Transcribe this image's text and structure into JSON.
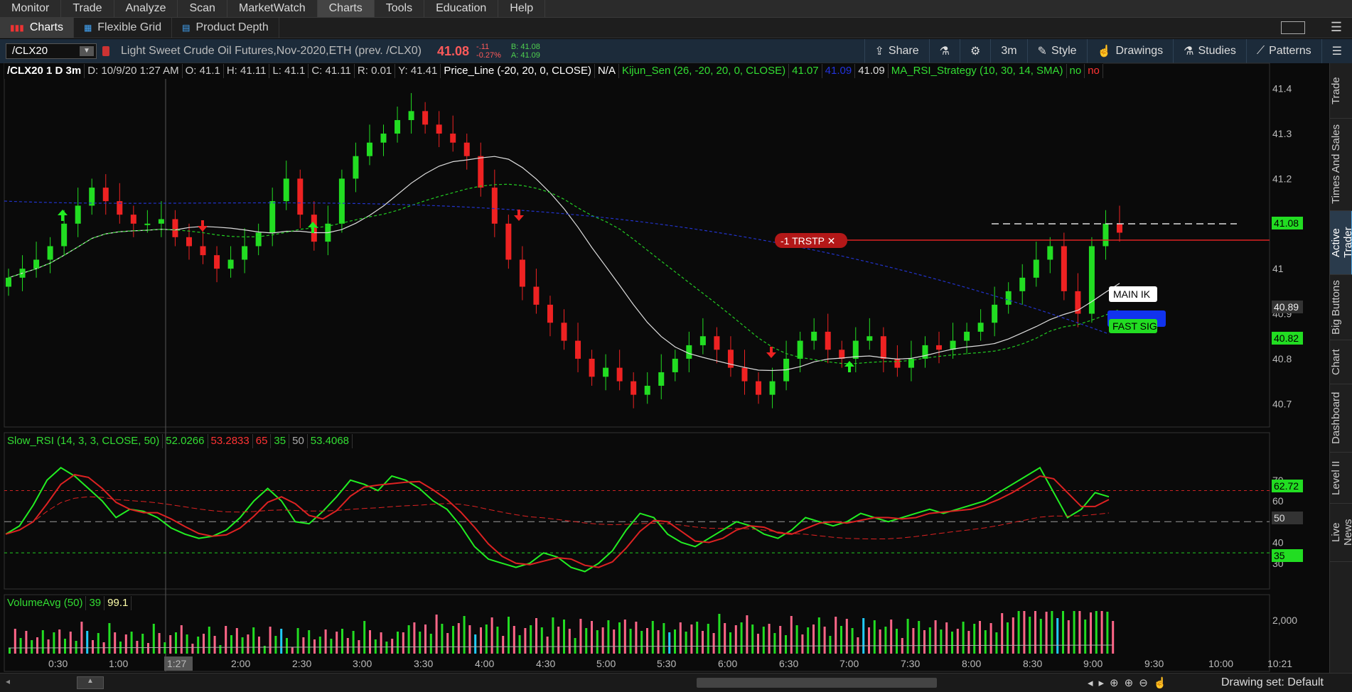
{
  "menu": [
    "Monitor",
    "Trade",
    "Analyze",
    "Scan",
    "MarketWatch",
    "Charts",
    "Tools",
    "Education",
    "Help"
  ],
  "menu_active": "Charts",
  "subtabs": [
    {
      "label": "Charts",
      "icon": "bar-chart-icon",
      "active": true
    },
    {
      "label": "Flexible Grid",
      "icon": "grid-icon",
      "active": false
    },
    {
      "label": "Product Depth",
      "icon": "depth-icon",
      "active": false
    }
  ],
  "toolbar": {
    "symbol": "/CLX20",
    "description": "Light Sweet Crude Oil Futures,Nov-2020,ETH (prev. /CLX0)",
    "last": "41.08",
    "change": "-.11",
    "change_pct": "-0.27%",
    "bid": "B: 41.08",
    "ask": "A: 41.09",
    "share": "Share",
    "period": "3m",
    "style": "Style",
    "drawings": "Drawings",
    "studies": "Studies",
    "patterns": "Patterns"
  },
  "infobar": {
    "title": "/CLX20 1 D 3m",
    "date": "D: 10/9/20 1:27 AM",
    "open": "O: 41.1",
    "high": "H: 41.11",
    "low": "L: 41.1",
    "close": "C: 41.11",
    "range": "R: 0.01",
    "y": "Y: 41.41",
    "price_line": "Price_Line (-20, 20, 0, CLOSE)",
    "price_line_val": "N/A",
    "kijun": "Kijun_Sen (26, -20, 20, 0, CLOSE)",
    "kijun_v1": "41.07",
    "kijun_v2": "41.09",
    "kijun_v3": "41.09",
    "strategy": "MA_RSI_Strategy (10, 30, 14, SMA)",
    "strategy_v1": "no",
    "strategy_v2": "no"
  },
  "price_panel": {
    "y_ticks": [
      "41.4",
      "41.3",
      "41.2",
      "41.1",
      "41",
      "40.9",
      "40.8",
      "40.7"
    ],
    "last_label": "41.08",
    "label_2": "40.89",
    "label_3": "40.82",
    "order_label": "-1 TRSTP",
    "main_label": "MAIN IK",
    "fast_label": "FAST SIG"
  },
  "rsi_panel": {
    "name": "Slow_RSI (14, 3, 3, CLOSE, 50)",
    "v1": "52.0266",
    "v2": "53.2833",
    "v3": "65",
    "v4": "35",
    "v5": "50",
    "v6": "53.4068",
    "y_ticks": [
      "70",
      "60",
      "40",
      "30"
    ],
    "label_last": "62.72",
    "label_50": "50",
    "label_35": "35"
  },
  "vol_panel": {
    "name": "VolumeAvg (50)",
    "v1": "39",
    "v2": "99.1",
    "y_tick": "2,000"
  },
  "x_axis": [
    "0:30",
    "1:00",
    "1:27",
    "2:00",
    "2:30",
    "3:00",
    "3:30",
    "4:00",
    "4:30",
    "5:00",
    "5:30",
    "6:00",
    "6:30",
    "7:00",
    "7:30",
    "8:00",
    "8:30",
    "9:00",
    "9:30",
    "10:00",
    "10:21"
  ],
  "right_tabs": [
    "Trade",
    "Times And Sales",
    "Active Trader",
    "Big Buttons",
    "Chart",
    "Dashboard",
    "Level II",
    "Live News"
  ],
  "right_tab_active": "Active Trader",
  "bottom": {
    "drawing_set": "Drawing set: Default"
  },
  "colors": {
    "up": "#22dd22",
    "down": "#ee2222",
    "toolbar_bg": "#1c2b3a"
  },
  "chart_data": {
    "type": "candlestick",
    "interval": "3m",
    "closes": [
      40.98,
      41.0,
      41.02,
      41.05,
      41.1,
      41.14,
      41.18,
      41.15,
      41.12,
      41.1,
      41.1,
      41.11,
      41.07,
      41.05,
      41.03,
      41.0,
      41.02,
      41.05,
      41.08,
      41.15,
      41.2,
      41.12,
      41.06,
      41.1,
      41.2,
      41.25,
      41.28,
      41.3,
      41.33,
      41.35,
      41.32,
      41.3,
      41.28,
      41.25,
      41.18,
      41.1,
      41.02,
      40.96,
      40.92,
      40.88,
      40.84,
      40.8,
      40.76,
      40.78,
      40.75,
      40.72,
      40.74,
      40.77,
      40.8,
      40.83,
      40.85,
      40.82,
      40.78,
      40.75,
      40.72,
      40.75,
      40.8,
      40.84,
      40.86,
      40.82,
      40.8,
      40.84,
      40.85,
      40.8,
      40.78,
      40.8,
      40.83,
      40.82,
      40.84,
      40.86,
      40.88,
      40.92,
      40.95,
      40.98,
      41.02,
      41.05,
      40.95,
      40.9,
      41.05,
      41.1,
      41.08
    ]
  }
}
